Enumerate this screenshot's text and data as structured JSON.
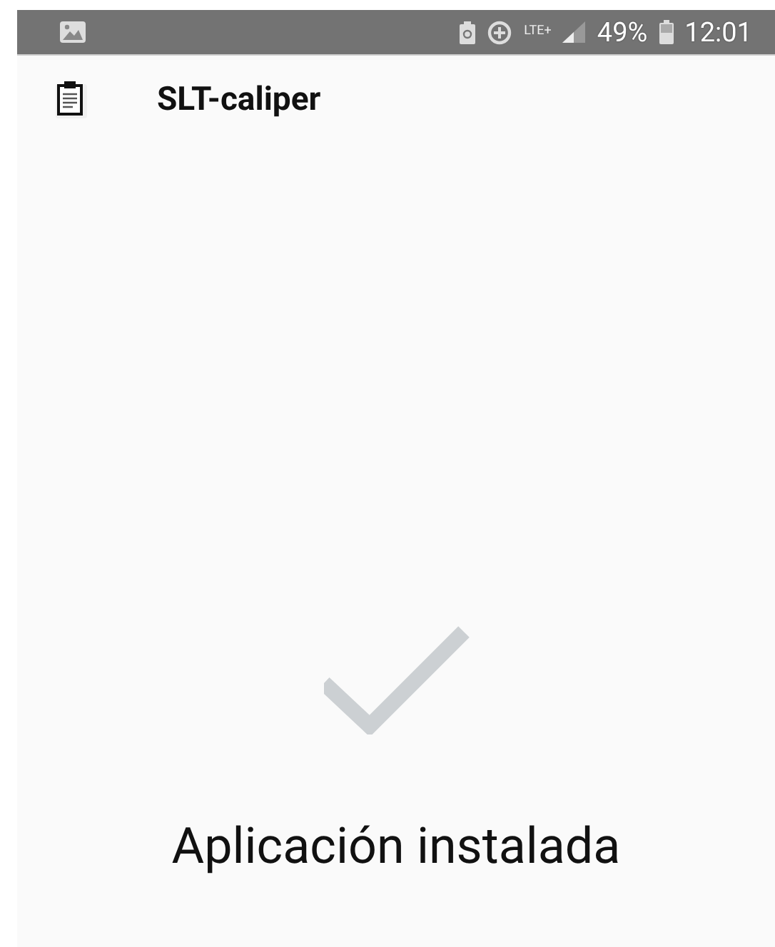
{
  "status_bar": {
    "network": "LTE+",
    "battery": "49%",
    "time": "12:01"
  },
  "app_bar": {
    "title": "SLT-caliper"
  },
  "result": {
    "message": "Aplicación instalada"
  }
}
